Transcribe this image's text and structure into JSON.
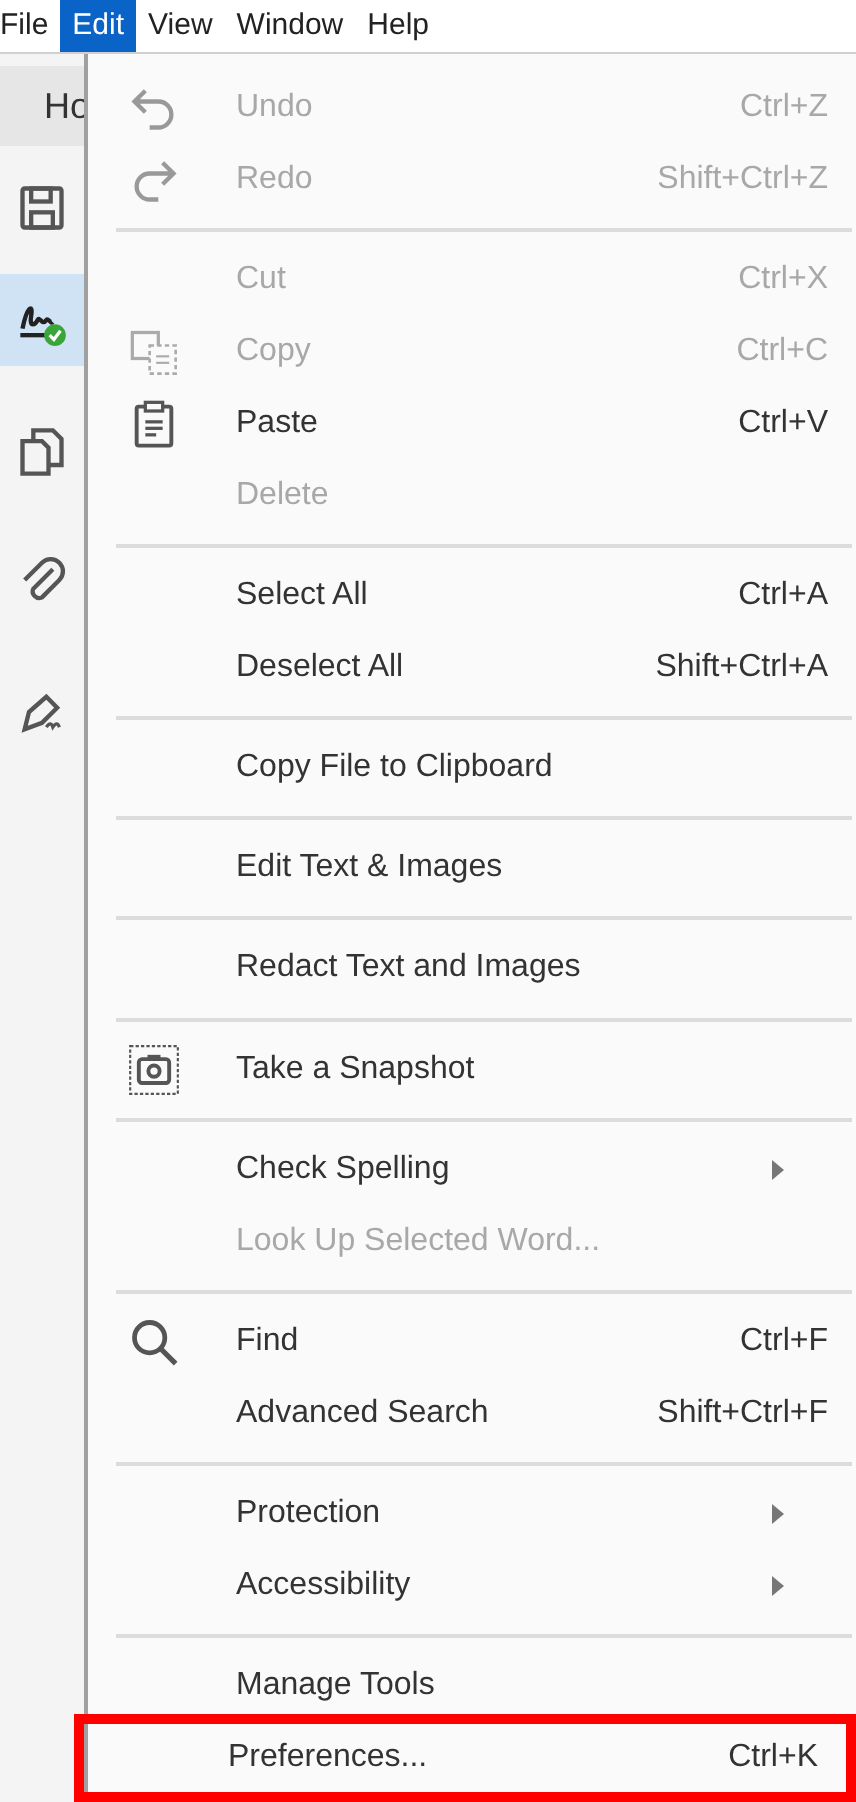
{
  "menubar": [
    {
      "label": "File",
      "selected": false
    },
    {
      "label": "Edit",
      "selected": true
    },
    {
      "label": "View",
      "selected": false
    },
    {
      "label": "Window",
      "selected": false
    },
    {
      "label": "Help",
      "selected": false
    }
  ],
  "home_tab": {
    "label": "Ho"
  },
  "sidebar": [
    {
      "kind": "save",
      "selected": false
    },
    {
      "kind": "signature",
      "selected": true
    },
    {
      "kind": "pages",
      "selected": false
    },
    {
      "kind": "attachment",
      "selected": false
    },
    {
      "kind": "sign",
      "selected": false
    }
  ],
  "menu": {
    "groups": [
      [
        {
          "label": "Undo",
          "shortcut": "Ctrl+Z",
          "disabled": true,
          "kind": "undo"
        },
        {
          "label": "Redo",
          "shortcut": "Shift+Ctrl+Z",
          "disabled": true,
          "kind": "redo"
        }
      ],
      [
        {
          "label": "Cut",
          "shortcut": "Ctrl+X",
          "disabled": true,
          "kind": "plain"
        },
        {
          "label": "Copy",
          "shortcut": "Ctrl+C",
          "disabled": true,
          "kind": "copy"
        },
        {
          "label": "Paste",
          "shortcut": "Ctrl+V",
          "disabled": false,
          "kind": "paste"
        },
        {
          "label": "Delete",
          "disabled": true,
          "kind": "plain"
        }
      ],
      [
        {
          "label": "Select All",
          "shortcut": "Ctrl+A",
          "disabled": false,
          "kind": "plain"
        },
        {
          "label": "Deselect All",
          "shortcut": "Shift+Ctrl+A",
          "disabled": false,
          "kind": "plain"
        }
      ],
      [
        {
          "label": "Copy File to Clipboard",
          "disabled": false,
          "kind": "plain"
        }
      ],
      [
        {
          "label": "Edit Text & Images",
          "disabled": false,
          "kind": "plain"
        }
      ],
      [
        {
          "label": "Redact Text and Images",
          "disabled": false,
          "kind": "plain"
        }
      ],
      [
        {
          "label": "Take a Snapshot",
          "disabled": false,
          "kind": "camera"
        }
      ],
      [
        {
          "label": "Check Spelling",
          "disabled": false,
          "submenu": true,
          "kind": "plain"
        },
        {
          "label": "Look Up Selected Word...",
          "disabled": true,
          "kind": "plain"
        }
      ],
      [
        {
          "label": "Find",
          "shortcut": "Ctrl+F",
          "disabled": false,
          "kind": "search"
        },
        {
          "label": "Advanced Search",
          "shortcut": "Shift+Ctrl+F",
          "disabled": false,
          "kind": "plain"
        }
      ],
      [
        {
          "label": "Protection",
          "disabled": false,
          "submenu": true,
          "kind": "plain"
        },
        {
          "label": "Accessibility",
          "disabled": false,
          "submenu": true,
          "kind": "plain"
        }
      ],
      [
        {
          "label": "Manage Tools",
          "disabled": false,
          "kind": "plain"
        },
        {
          "label": "Preferences...",
          "shortcut": "Ctrl+K",
          "disabled": false,
          "highlighted": true,
          "kind": "plain"
        }
      ]
    ]
  }
}
